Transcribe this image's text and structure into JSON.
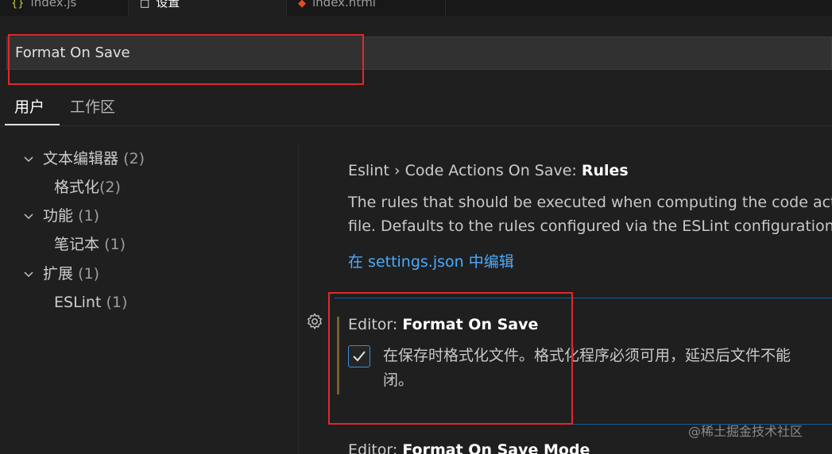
{
  "tabs": [
    {
      "label": "index.js",
      "icon": "js-file-icon"
    },
    {
      "label": "设置",
      "icon": "settings-file-icon"
    },
    {
      "label": "index.html",
      "icon": "html-file-icon"
    }
  ],
  "search": {
    "value": "Format On Save"
  },
  "scope_tabs": {
    "user": "用户",
    "workspace": "工作区"
  },
  "toc": [
    {
      "label": "文本编辑器",
      "count": "(2)",
      "level": 0,
      "expanded": true
    },
    {
      "label": "格式化",
      "count": "(2)",
      "level": 1
    },
    {
      "label": "功能",
      "count": "(1)",
      "level": 0,
      "expanded": true
    },
    {
      "label": "笔记本",
      "count": "(1)",
      "level": 1
    },
    {
      "label": "扩展",
      "count": "(1)",
      "level": 0,
      "expanded": true
    },
    {
      "label": "ESLint",
      "count": "(1)",
      "level": 1
    }
  ],
  "settings": {
    "eslint_rules": {
      "category": "Eslint › Code Actions On Save: ",
      "name": "Rules",
      "description_line1": "The rules that should be executed when computing the code act",
      "description_line2": "file. Defaults to the rules configured via the ESLint configuration",
      "link": "在 settings.json 中编辑"
    },
    "format_on_save": {
      "category": "Editor: ",
      "name": "Format On Save",
      "checked": true,
      "description_line1": "在保存时格式化文件。格式化程序必须可用，延迟后文件不能",
      "description_line2": "闭。"
    },
    "format_on_save_mode": {
      "category": "Editor: ",
      "name": "Format On Save Mode"
    }
  },
  "watermark": "@稀土掘金技术社区",
  "colors": {
    "accent": "#4daafc",
    "highlight_box": "#e0282e",
    "focus_border": "#0e639c",
    "modified_indicator": "#7a5f2e"
  }
}
